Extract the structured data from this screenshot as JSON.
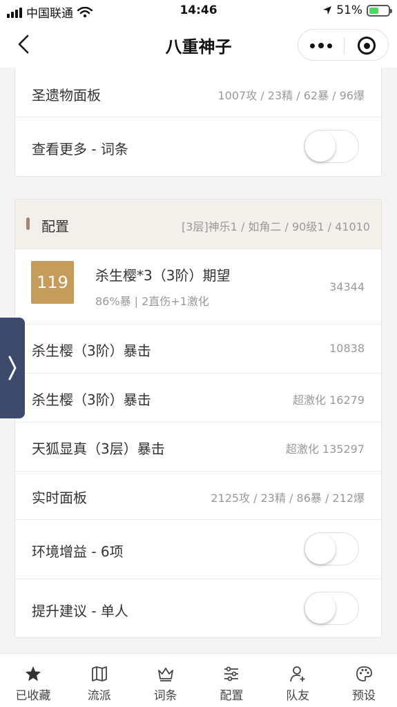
{
  "status_bar": {
    "carrier": "中国联通",
    "time": "14:46",
    "battery": "51%"
  },
  "nav": {
    "title": "八重神子"
  },
  "top_card": {
    "rows": [
      {
        "label": "圣遗物面板",
        "value": "1007攻 / 23精 / 62暴 / 96爆"
      },
      {
        "label": "查看更多 - 词条"
      }
    ]
  },
  "config_card": {
    "header_title": "配置",
    "header_summary": "[3层]神乐1 / 如角二 / 90级1 / 41010",
    "main_item": {
      "badge": "119",
      "title": "杀生樱*3（3阶）期望",
      "subtitle": "86%暴 | 2直伤+1激化",
      "value": "34344"
    },
    "rows": [
      {
        "label": "杀生樱（3阶）暴击",
        "value": "10838"
      },
      {
        "label": "杀生樱（3阶）暴击",
        "value": "超激化 16279"
      },
      {
        "label": "天狐显真（3层）暴击",
        "value": "超激化 135297"
      },
      {
        "label": "实时面板",
        "value": "2125攻 / 23精 / 86暴 / 212爆"
      }
    ],
    "toggles": [
      {
        "label": "环境增益 - 6项"
      },
      {
        "label": "提升建议 - 单人"
      }
    ]
  },
  "tab_bar": {
    "tabs": [
      {
        "label": "已收藏",
        "icon": "star-icon"
      },
      {
        "label": "流派",
        "icon": "map-icon"
      },
      {
        "label": "词条",
        "icon": "crown-icon"
      },
      {
        "label": "配置",
        "icon": "sliders-icon"
      },
      {
        "label": "队友",
        "icon": "add-user-icon"
      },
      {
        "label": "预设",
        "icon": "palette-icon"
      }
    ]
  },
  "colors": {
    "accent_badge": "#c59c5a",
    "side_tab": "#3d4a6b",
    "config_header_bg": "#f3efea"
  }
}
